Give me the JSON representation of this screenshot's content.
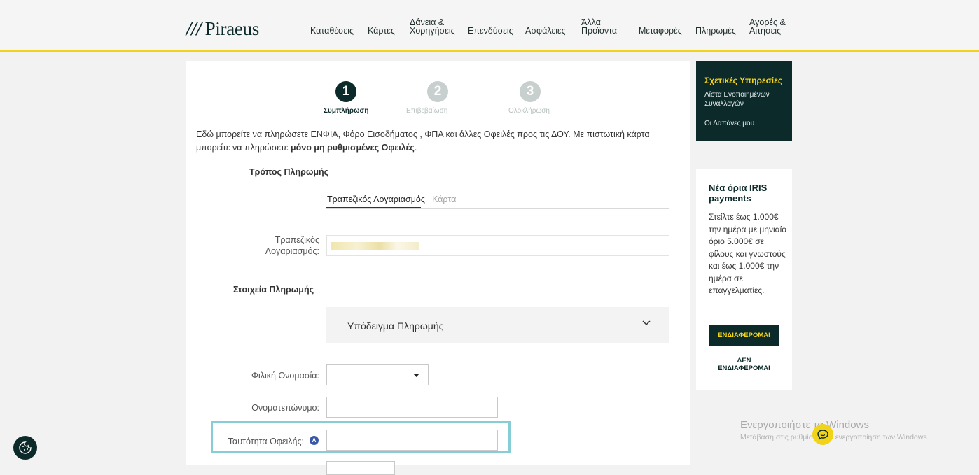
{
  "header": {
    "logo_slashes": "///",
    "logo_text": "Piraeus",
    "nav": {
      "deposits": "Καταθέσεις",
      "cards": "Κάρτες",
      "loans_1": "Δάνεια &",
      "loans_2": "Χορηγήσεις",
      "investments": "Επενδύσεις",
      "insurance": "Ασφάλειες",
      "other_1": "Άλλα",
      "other_2": "Προϊόντα",
      "transfers": "Μεταφορές",
      "payments": "Πληρωμές",
      "purchases_1": "Αγορές &",
      "purchases_2": "Αιτήσεις"
    }
  },
  "stepper": {
    "steps": [
      {
        "number": "1",
        "label": "Συμπλήρωση",
        "active": true
      },
      {
        "number": "2",
        "label": "Επιβεβαίωση",
        "active": false
      },
      {
        "number": "3",
        "label": "Ολοκλήρωση",
        "active": false
      }
    ]
  },
  "intro": {
    "text_1": "Εδώ μπορείτε να πληρώσετε ΕΝΦΙΑ, Φόρο Εισοδήματος , ΦΠΑ και άλλες Οφειλές προς τις ΔΟΥ. Με πιστωτική κάρτα μπορείτε να πληρώσετε ",
    "text_bold": "μόνο μη ρυθμισμένες Οφειλές",
    "text_end": "."
  },
  "form": {
    "payment_method_label": "Τρόπος Πληρωμής",
    "tab_account": "Τραπεζικός Λογαριασμός",
    "tab_card": "Κάρτα",
    "account_label_1": "Τραπεζικός",
    "account_label_2": "Λογαριασμός:",
    "payment_details_label": "Στοιχεία Πληρωμής",
    "template_label": "Υπόδειγμα Πληρωμής",
    "nickname_label": "Φιλική Ονομασία:",
    "nickname_value": "",
    "fullname_label": "Ονοματεπώνυμο:",
    "fullname_value": "",
    "debt_id_label": "Ταυτότητα Οφειλής:",
    "debt_id_value": "",
    "info_icon_letter": "A"
  },
  "sidebar": {
    "related_title": "Σχετικές Υπηρεσίες",
    "related_link_1a": "Λίστα Ενοποιημένων",
    "related_link_1b": "Συναλλαγών",
    "related_link_2": "Οι Δαπάνες μου",
    "iris_title": "Νέα όρια IRIS payments",
    "iris_body": "Στείλτε έως 1.000€ την ημέρα με μηνιαίο όριο 5.000€ σε φίλους και γνωστούς και έως 1.000€ την ημέρα σε επαγγελματίες.",
    "iris_btn_yes": "ΕΝΔΙΑΦΕΡΟΜΑΙ",
    "iris_btn_no_1": "ΔΕΝ",
    "iris_btn_no_2": "ΕΝΔΙΑΦΕΡΟΜΑΙ"
  },
  "watermark": {
    "line1": "Ενεργοποιήστε τα Windows",
    "line2": "Μετάβαση στις ρυθμίσεις για ενεργοποίηση των Windows."
  },
  "icons": {
    "chevron": "chevron-down-icon",
    "dropdown": "caret-down-icon",
    "chat": "chat-icon",
    "cookie": "cookie-icon",
    "info": "info-icon"
  },
  "colors": {
    "brand_dark": "#0d2a2a",
    "brand_yellow": "#f1d31a",
    "highlight": "#86cdd6",
    "step_inactive": "#c8cfcf"
  }
}
